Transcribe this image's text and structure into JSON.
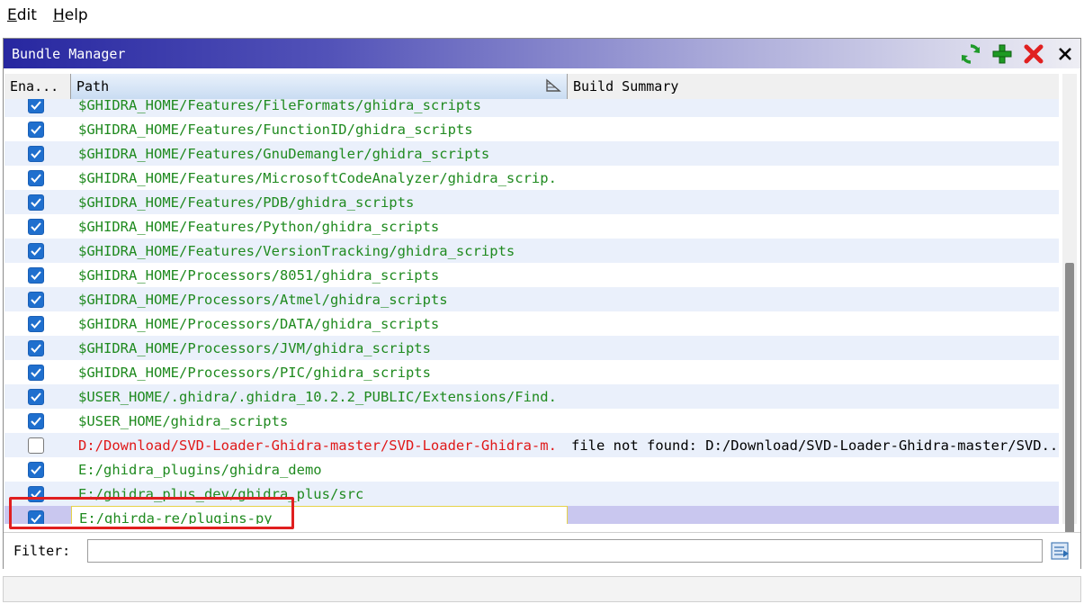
{
  "menu": [
    {
      "mnemonic": "E",
      "rest": "dit"
    },
    {
      "mnemonic": "H",
      "rest": "elp"
    }
  ],
  "panel": {
    "title": "Bundle Manager",
    "tools": [
      "refresh-icon",
      "add-icon",
      "remove-icon",
      "close-icon"
    ]
  },
  "columns": {
    "enabled": "Ena...",
    "path": "Path",
    "summary": "Build Summary"
  },
  "rows": [
    {
      "enabled": true,
      "path": "$GHIDRA_HOME/Features/FileFormats/ghidra_scripts",
      "status": "ok",
      "summary": ""
    },
    {
      "enabled": true,
      "path": "$GHIDRA_HOME/Features/FunctionID/ghidra_scripts",
      "status": "ok",
      "summary": ""
    },
    {
      "enabled": true,
      "path": "$GHIDRA_HOME/Features/GnuDemangler/ghidra_scripts",
      "status": "ok",
      "summary": ""
    },
    {
      "enabled": true,
      "path": "$GHIDRA_HOME/Features/MicrosoftCodeAnalyzer/ghidra_scrip.",
      "status": "ok",
      "summary": ""
    },
    {
      "enabled": true,
      "path": "$GHIDRA_HOME/Features/PDB/ghidra_scripts",
      "status": "ok",
      "summary": ""
    },
    {
      "enabled": true,
      "path": "$GHIDRA_HOME/Features/Python/ghidra_scripts",
      "status": "ok",
      "summary": ""
    },
    {
      "enabled": true,
      "path": "$GHIDRA_HOME/Features/VersionTracking/ghidra_scripts",
      "status": "ok",
      "summary": ""
    },
    {
      "enabled": true,
      "path": "$GHIDRA_HOME/Processors/8051/ghidra_scripts",
      "status": "ok",
      "summary": ""
    },
    {
      "enabled": true,
      "path": "$GHIDRA_HOME/Processors/Atmel/ghidra_scripts",
      "status": "ok",
      "summary": ""
    },
    {
      "enabled": true,
      "path": "$GHIDRA_HOME/Processors/DATA/ghidra_scripts",
      "status": "ok",
      "summary": ""
    },
    {
      "enabled": true,
      "path": "$GHIDRA_HOME/Processors/JVM/ghidra_scripts",
      "status": "ok",
      "summary": ""
    },
    {
      "enabled": true,
      "path": "$GHIDRA_HOME/Processors/PIC/ghidra_scripts",
      "status": "ok",
      "summary": ""
    },
    {
      "enabled": true,
      "path": "$USER_HOME/.ghidra/.ghidra_10.2.2_PUBLIC/Extensions/Find.",
      "status": "ok",
      "summary": ""
    },
    {
      "enabled": true,
      "path": "$USER_HOME/ghidra_scripts",
      "status": "ok",
      "summary": ""
    },
    {
      "enabled": false,
      "path": "D:/Download/SVD-Loader-Ghidra-master/SVD-Loader-Ghidra-m.",
      "status": "error",
      "summary": "file not found: D:/Download/SVD-Loader-Ghidra-master/SVD..."
    },
    {
      "enabled": true,
      "path": "E:/ghidra_plugins/ghidra_demo",
      "status": "ok",
      "summary": ""
    },
    {
      "enabled": true,
      "path": "E:/ghidra_plus_dev/ghidra_plus/src",
      "status": "ok",
      "summary": ""
    },
    {
      "enabled": true,
      "path": "E:/ghirda-re/plugins-py",
      "status": "ok",
      "summary": "",
      "selected": true
    }
  ],
  "scroll": {
    "thumb_start": 0.42,
    "thumb_fraction": 0.6
  },
  "filter": {
    "label": "Filter:",
    "value": "",
    "placeholder": ""
  },
  "colors": {
    "ok_path": "#1f8a1f",
    "error_path": "#e01818",
    "selected_row": "#c9c7ef",
    "highlight": "#e01f1f"
  }
}
